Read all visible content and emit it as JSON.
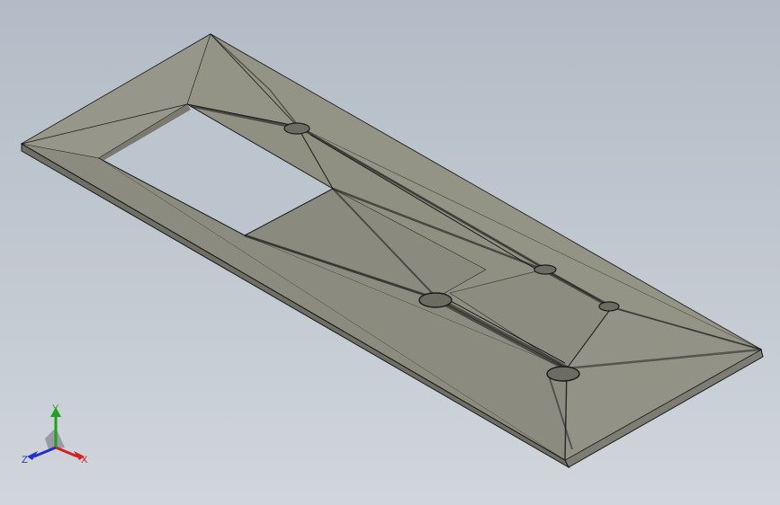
{
  "viewport": {
    "background_top": "#b3bcc6",
    "background_bottom": "#d1d6dc",
    "part_face_color": "#8f8f82",
    "part_edge_color": "#1a1a1a",
    "hole_color": "#6c6c63"
  },
  "triad": {
    "x_label": "X",
    "y_label": "Y",
    "z_label": "Z",
    "x_color": "#d42020",
    "y_color": "#20a020",
    "z_color": "#2030d0"
  }
}
